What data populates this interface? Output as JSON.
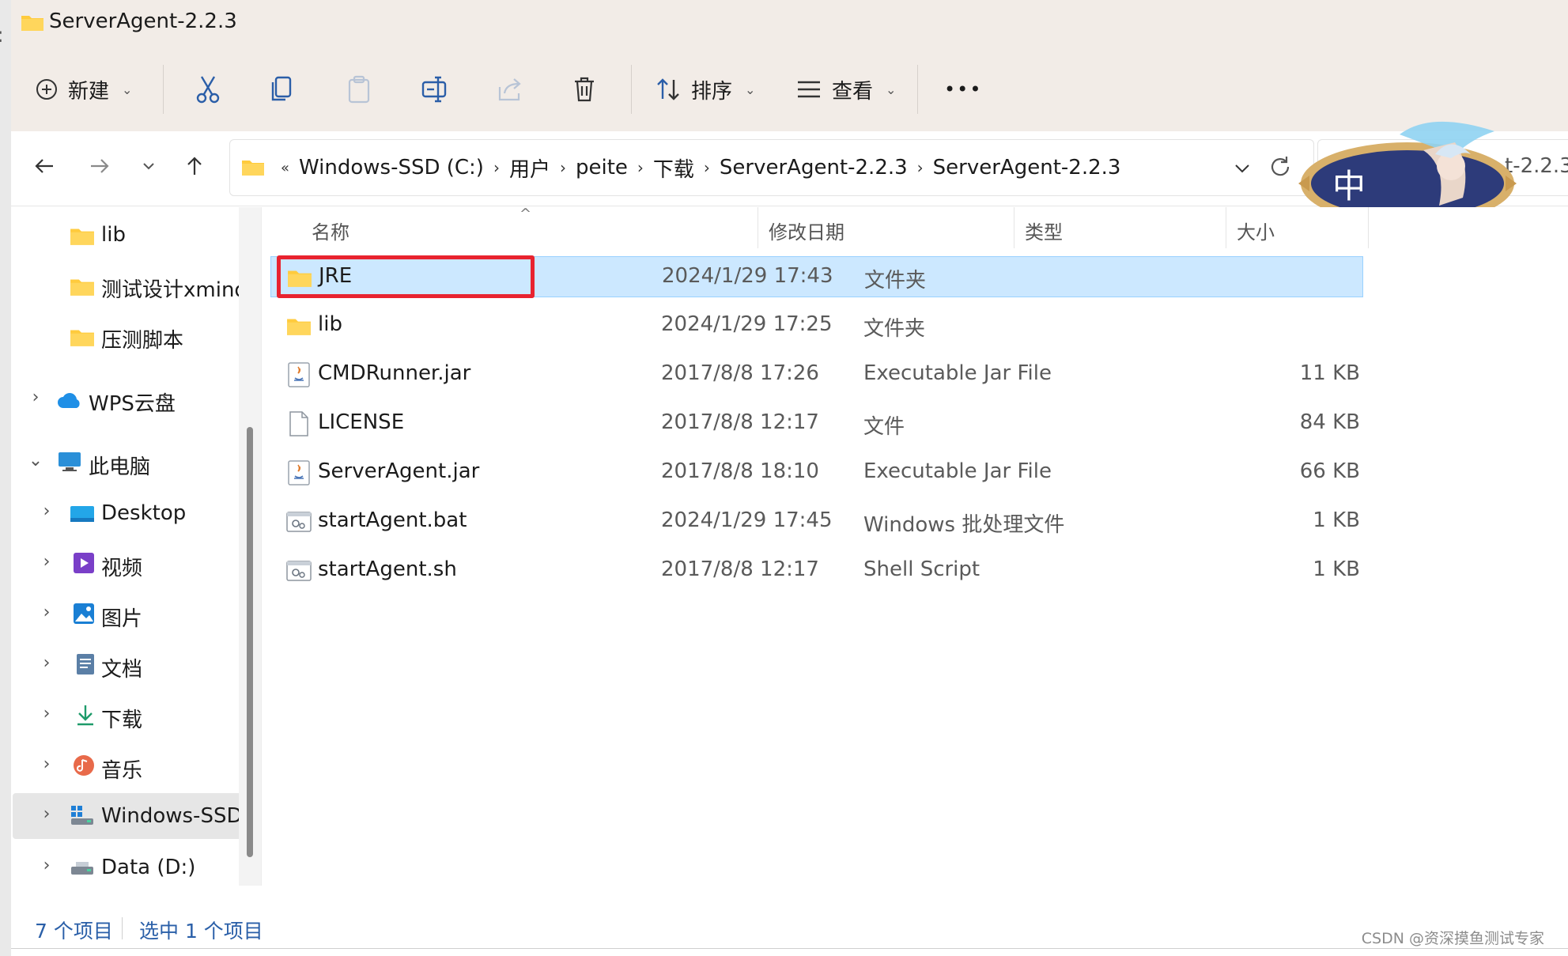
{
  "window": {
    "title": "ServerAgent-2.2.3"
  },
  "commandbar": {
    "new_label": "新建",
    "sort_label": "排序",
    "view_label": "查看",
    "more_label": "•••"
  },
  "address": {
    "overflow": "«",
    "crumbs": [
      "Windows-SSD (C:)",
      "用户",
      "peite",
      "下载",
      "ServerAgent-2.2.3",
      "ServerAgent-2.2.3"
    ],
    "search_partial": "t-2.2.3"
  },
  "sidebar": {
    "items": [
      {
        "label": "lib",
        "icon": "folder-icon"
      },
      {
        "label": "测试设计xmind",
        "icon": "folder-icon"
      },
      {
        "label": "压测脚本",
        "icon": "folder-icon"
      },
      {
        "label": "WPS云盘",
        "icon": "cloud-icon"
      },
      {
        "label": "此电脑",
        "icon": "monitor-icon"
      },
      {
        "label": "Desktop",
        "icon": "desktop-icon"
      },
      {
        "label": "视频",
        "icon": "video-icon"
      },
      {
        "label": "图片",
        "icon": "picture-icon"
      },
      {
        "label": "文档",
        "icon": "document-icon"
      },
      {
        "label": "下载",
        "icon": "download-icon"
      },
      {
        "label": "音乐",
        "icon": "music-icon"
      },
      {
        "label": "Windows-SSD",
        "icon": "drive-c-icon"
      },
      {
        "label": "Data (D:)",
        "icon": "drive-d-icon"
      }
    ]
  },
  "columns": {
    "name": "名称",
    "date": "修改日期",
    "type": "类型",
    "size": "大小"
  },
  "files": [
    {
      "name": "JRE",
      "date": "2024/1/29 17:43",
      "type": "文件夹",
      "size": "",
      "icon": "folder-icon",
      "selected": true
    },
    {
      "name": "lib",
      "date": "2024/1/29 17:25",
      "type": "文件夹",
      "size": "",
      "icon": "folder-icon"
    },
    {
      "name": "CMDRunner.jar",
      "date": "2017/8/8 17:26",
      "type": "Executable Jar File",
      "size": "11 KB",
      "icon": "java-jar-icon"
    },
    {
      "name": "LICENSE",
      "date": "2017/8/8 12:17",
      "type": "文件",
      "size": "84 KB",
      "icon": "blank-file-icon"
    },
    {
      "name": "ServerAgent.jar",
      "date": "2017/8/8 18:10",
      "type": "Executable Jar File",
      "size": "66 KB",
      "icon": "java-jar-icon"
    },
    {
      "name": "startAgent.bat",
      "date": "2024/1/29 17:45",
      "type": "Windows 批处理文件",
      "size": "1 KB",
      "icon": "batch-file-icon"
    },
    {
      "name": "startAgent.sh",
      "date": "2017/8/8 12:17",
      "type": "Shell Script",
      "size": "1 KB",
      "icon": "script-file-icon"
    }
  ],
  "status": {
    "count": "7 个项目",
    "selection": "选中 1 个项目"
  },
  "overlay": {
    "badge_char": "中"
  },
  "watermark": "CSDN @资深摸鱼测试专家",
  "colors": {
    "accent_red": "#e8232f",
    "selection_blue": "#cce8ff",
    "folder_yellow": "#ffcb3d"
  }
}
